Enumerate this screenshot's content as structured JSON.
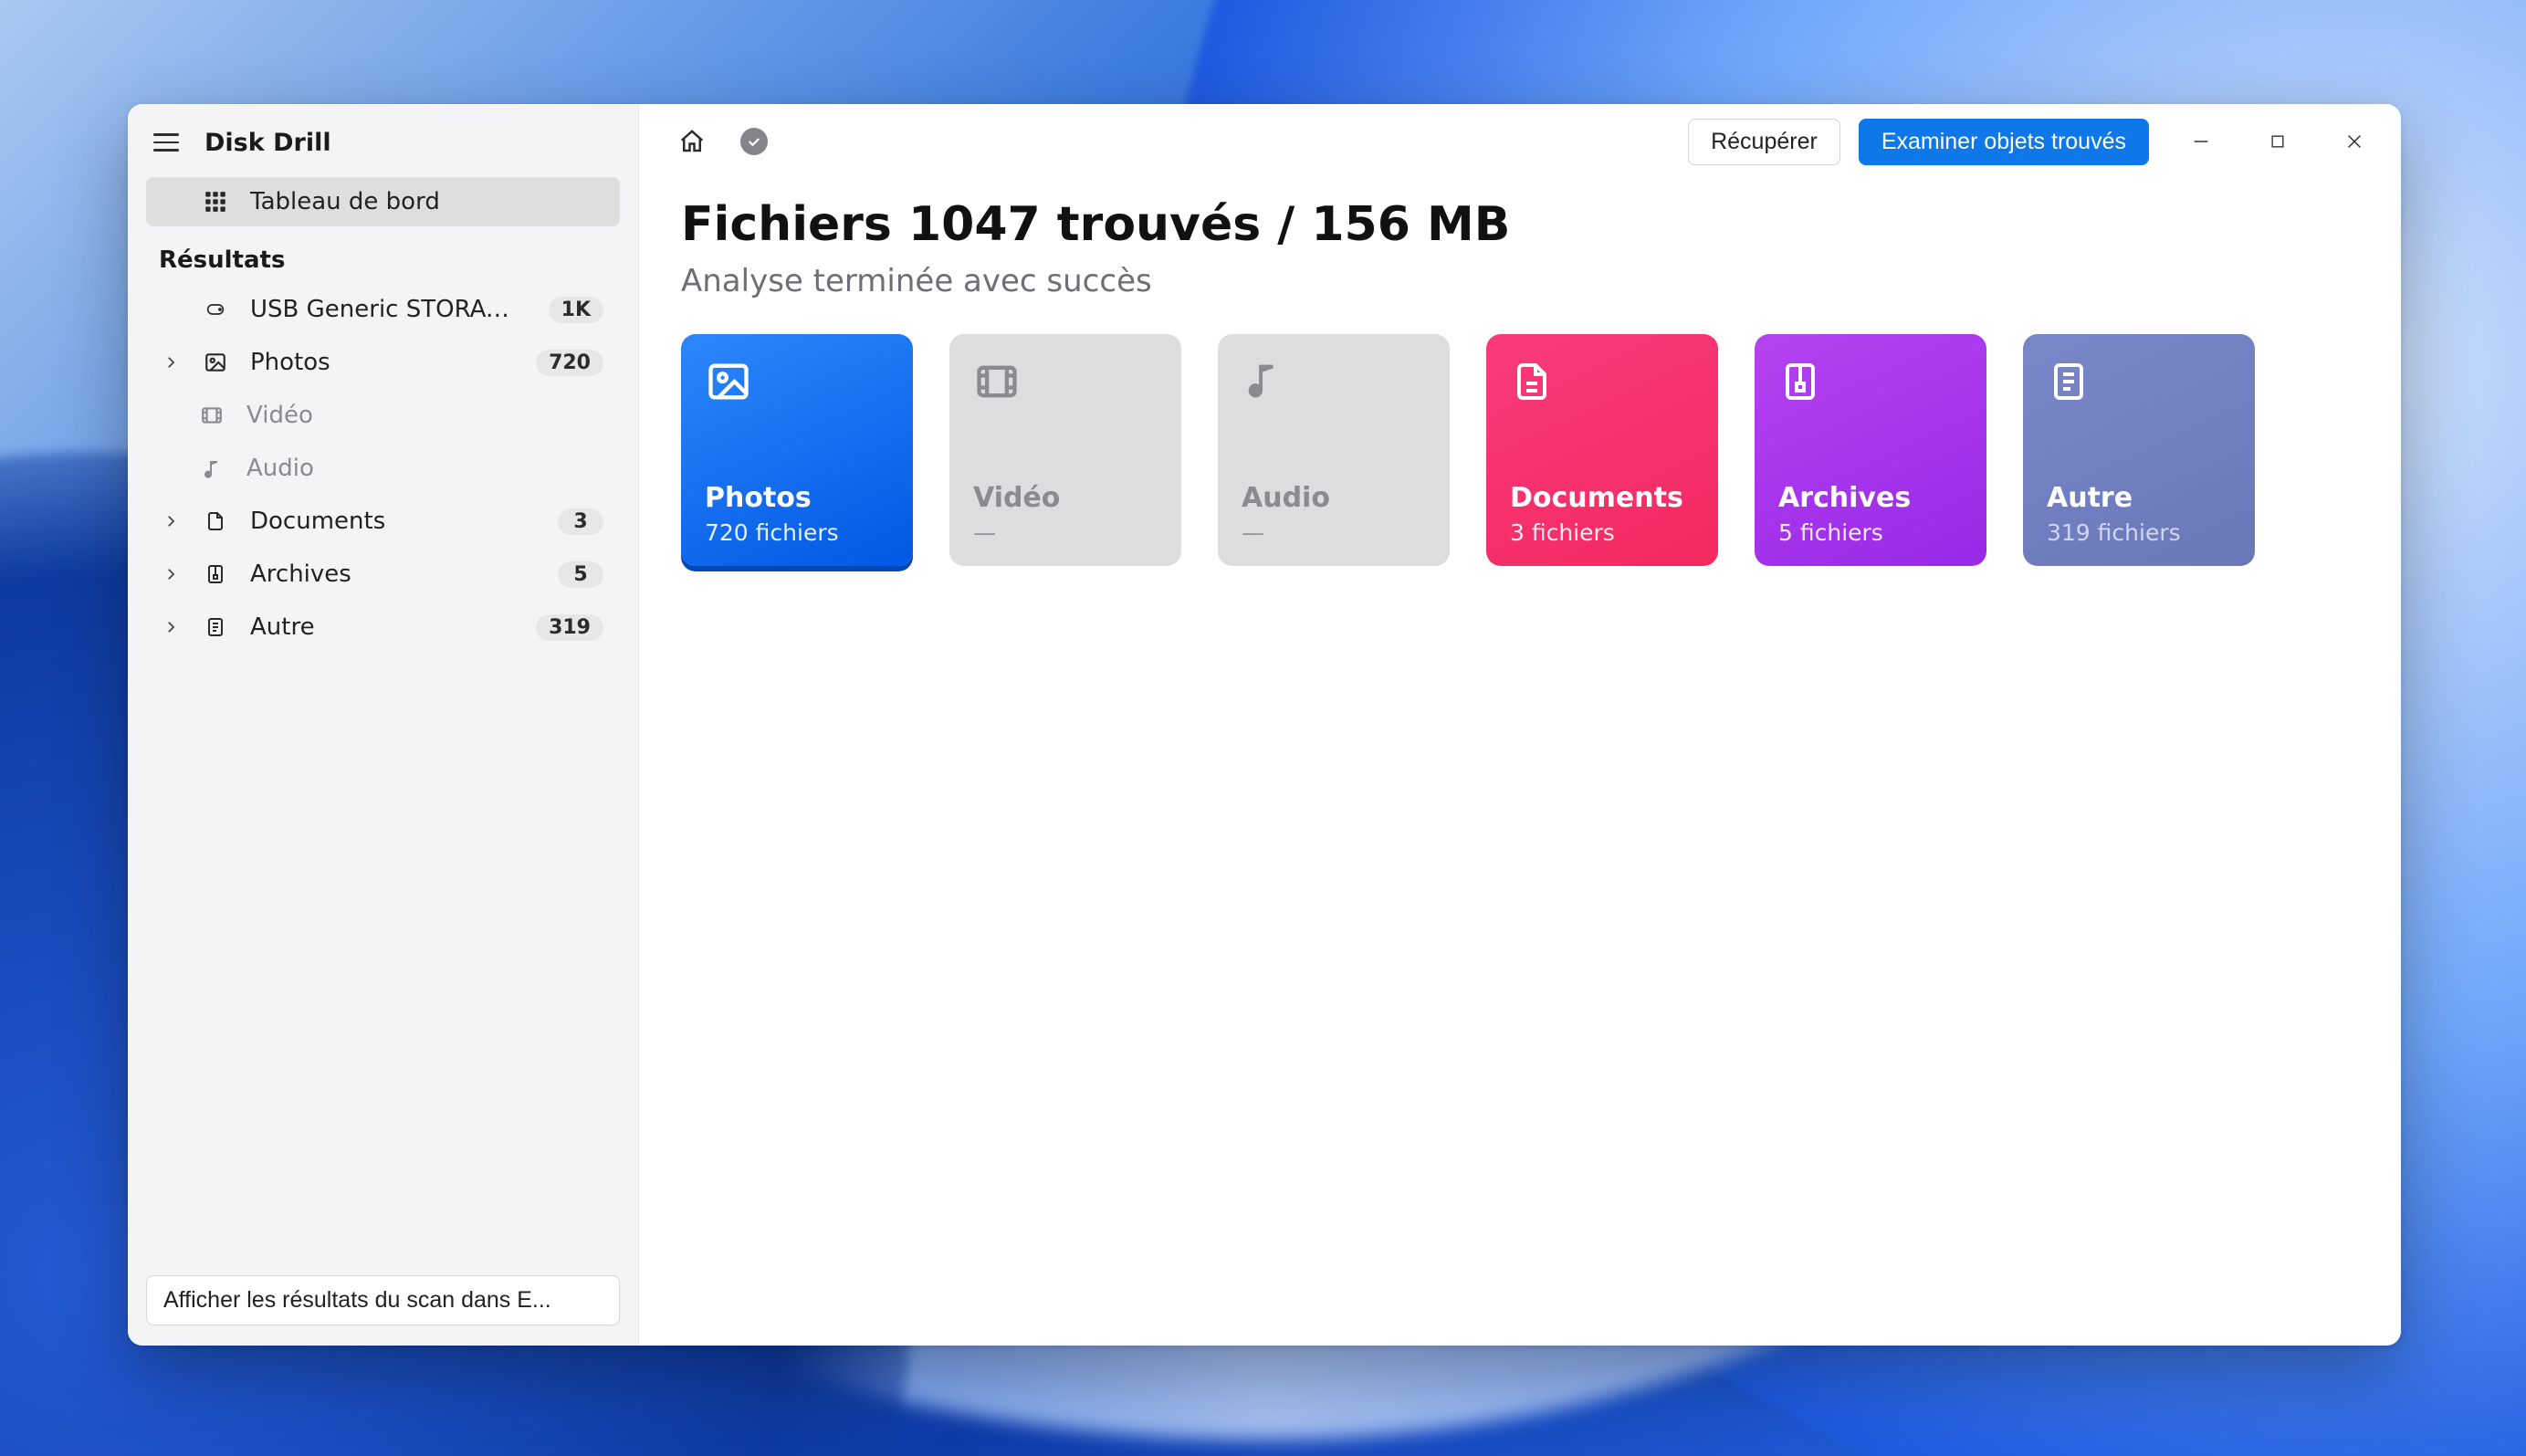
{
  "app": {
    "title": "Disk Drill"
  },
  "sidebar": {
    "dashboard": "Tableau de bord",
    "results_heading": "Résultats",
    "device": {
      "label": "USB Generic STORAGE D...",
      "count": "1K"
    },
    "items": [
      {
        "label": "Photos",
        "count": "720",
        "collapsible": true,
        "muted": false
      },
      {
        "label": "Vidéo",
        "count": "",
        "collapsible": false,
        "muted": true
      },
      {
        "label": "Audio",
        "count": "",
        "collapsible": false,
        "muted": true
      },
      {
        "label": "Documents",
        "count": "3",
        "collapsible": true,
        "muted": false
      },
      {
        "label": "Archives",
        "count": "5",
        "collapsible": true,
        "muted": false
      },
      {
        "label": "Autre",
        "count": "319",
        "collapsible": true,
        "muted": false
      }
    ],
    "footer_button": "Afficher les résultats du scan dans E..."
  },
  "toolbar": {
    "recover": "Récupérer",
    "examine": "Examiner objets trouvés"
  },
  "main": {
    "title": "Fichiers 1047 trouvés / 156 MB",
    "subtitle": "Analyse terminée avec succès",
    "cards": {
      "photos": {
        "title": "Photos",
        "sub": "720 fichiers"
      },
      "video": {
        "title": "Vidéo",
        "sub": "—"
      },
      "audio": {
        "title": "Audio",
        "sub": "—"
      },
      "documents": {
        "title": "Documents",
        "sub": "3 fichiers"
      },
      "archives": {
        "title": "Archives",
        "sub": "5 fichiers"
      },
      "other": {
        "title": "Autre",
        "sub": "319 fichiers"
      }
    }
  }
}
